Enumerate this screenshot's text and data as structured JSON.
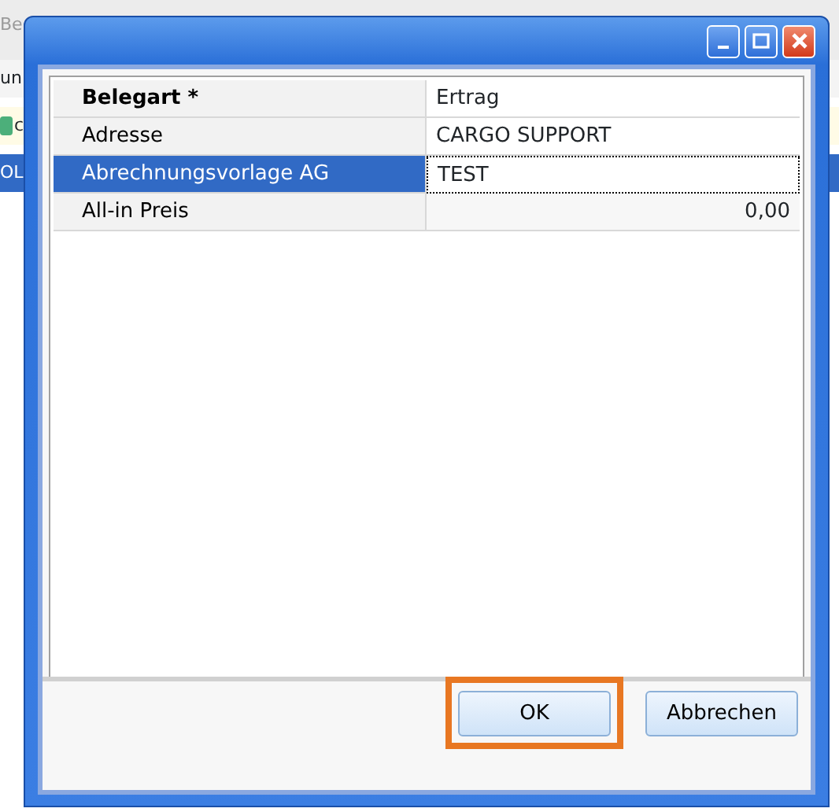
{
  "background": {
    "title": "Be",
    "rows": [
      {
        "kind": "plain",
        "text": "un",
        "selected": false
      },
      {
        "kind": "icon",
        "text": "c",
        "selected": false
      },
      {
        "kind": "plain",
        "text": "OL",
        "selected": true
      }
    ]
  },
  "dialog": {
    "properties": [
      {
        "label": "Belegart *",
        "value": "Ertrag",
        "required": true,
        "selected": false,
        "kind": "text"
      },
      {
        "label": "Adresse",
        "value": "CARGO SUPPORT",
        "required": false,
        "selected": false,
        "kind": "text"
      },
      {
        "label": "Abrechnungsvorlage AG",
        "value": "TEST",
        "required": false,
        "selected": true,
        "kind": "text"
      },
      {
        "label": "All-in Preis",
        "value": "0,00",
        "required": false,
        "selected": false,
        "kind": "number"
      }
    ],
    "buttons": [
      {
        "label": "OK",
        "highlighted": true
      },
      {
        "label": "Abbrechen",
        "highlighted": false
      }
    ]
  }
}
